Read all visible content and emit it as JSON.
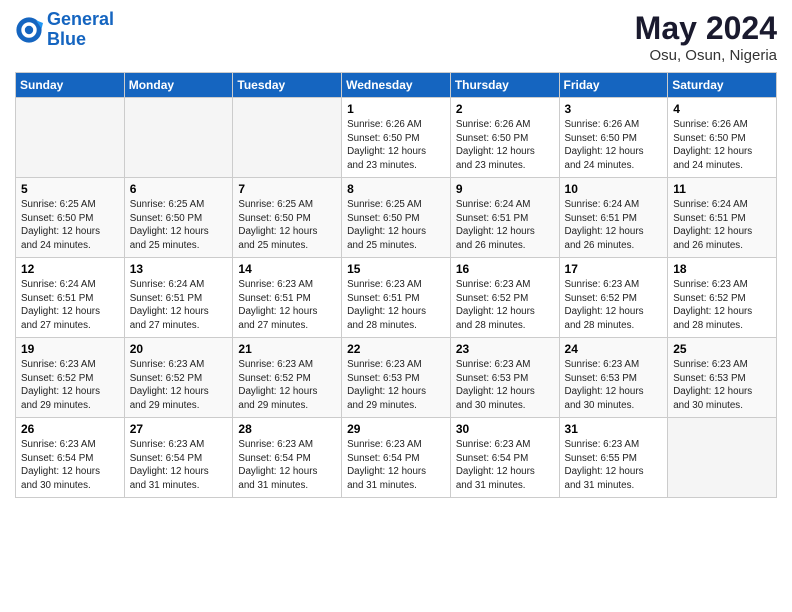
{
  "brand": {
    "line1": "General",
    "line2": "Blue"
  },
  "header": {
    "title": "May 2024",
    "location": "Osu, Osun, Nigeria"
  },
  "weekdays": [
    "Sunday",
    "Monday",
    "Tuesday",
    "Wednesday",
    "Thursday",
    "Friday",
    "Saturday"
  ],
  "weeks": [
    [
      {
        "day": "",
        "info": ""
      },
      {
        "day": "",
        "info": ""
      },
      {
        "day": "",
        "info": ""
      },
      {
        "day": "1",
        "info": "Sunrise: 6:26 AM\nSunset: 6:50 PM\nDaylight: 12 hours\nand 23 minutes."
      },
      {
        "day": "2",
        "info": "Sunrise: 6:26 AM\nSunset: 6:50 PM\nDaylight: 12 hours\nand 23 minutes."
      },
      {
        "day": "3",
        "info": "Sunrise: 6:26 AM\nSunset: 6:50 PM\nDaylight: 12 hours\nand 24 minutes."
      },
      {
        "day": "4",
        "info": "Sunrise: 6:26 AM\nSunset: 6:50 PM\nDaylight: 12 hours\nand 24 minutes."
      }
    ],
    [
      {
        "day": "5",
        "info": "Sunrise: 6:25 AM\nSunset: 6:50 PM\nDaylight: 12 hours\nand 24 minutes."
      },
      {
        "day": "6",
        "info": "Sunrise: 6:25 AM\nSunset: 6:50 PM\nDaylight: 12 hours\nand 25 minutes."
      },
      {
        "day": "7",
        "info": "Sunrise: 6:25 AM\nSunset: 6:50 PM\nDaylight: 12 hours\nand 25 minutes."
      },
      {
        "day": "8",
        "info": "Sunrise: 6:25 AM\nSunset: 6:50 PM\nDaylight: 12 hours\nand 25 minutes."
      },
      {
        "day": "9",
        "info": "Sunrise: 6:24 AM\nSunset: 6:51 PM\nDaylight: 12 hours\nand 26 minutes."
      },
      {
        "day": "10",
        "info": "Sunrise: 6:24 AM\nSunset: 6:51 PM\nDaylight: 12 hours\nand 26 minutes."
      },
      {
        "day": "11",
        "info": "Sunrise: 6:24 AM\nSunset: 6:51 PM\nDaylight: 12 hours\nand 26 minutes."
      }
    ],
    [
      {
        "day": "12",
        "info": "Sunrise: 6:24 AM\nSunset: 6:51 PM\nDaylight: 12 hours\nand 27 minutes."
      },
      {
        "day": "13",
        "info": "Sunrise: 6:24 AM\nSunset: 6:51 PM\nDaylight: 12 hours\nand 27 minutes."
      },
      {
        "day": "14",
        "info": "Sunrise: 6:23 AM\nSunset: 6:51 PM\nDaylight: 12 hours\nand 27 minutes."
      },
      {
        "day": "15",
        "info": "Sunrise: 6:23 AM\nSunset: 6:51 PM\nDaylight: 12 hours\nand 28 minutes."
      },
      {
        "day": "16",
        "info": "Sunrise: 6:23 AM\nSunset: 6:52 PM\nDaylight: 12 hours\nand 28 minutes."
      },
      {
        "day": "17",
        "info": "Sunrise: 6:23 AM\nSunset: 6:52 PM\nDaylight: 12 hours\nand 28 minutes."
      },
      {
        "day": "18",
        "info": "Sunrise: 6:23 AM\nSunset: 6:52 PM\nDaylight: 12 hours\nand 28 minutes."
      }
    ],
    [
      {
        "day": "19",
        "info": "Sunrise: 6:23 AM\nSunset: 6:52 PM\nDaylight: 12 hours\nand 29 minutes."
      },
      {
        "day": "20",
        "info": "Sunrise: 6:23 AM\nSunset: 6:52 PM\nDaylight: 12 hours\nand 29 minutes."
      },
      {
        "day": "21",
        "info": "Sunrise: 6:23 AM\nSunset: 6:52 PM\nDaylight: 12 hours\nand 29 minutes."
      },
      {
        "day": "22",
        "info": "Sunrise: 6:23 AM\nSunset: 6:53 PM\nDaylight: 12 hours\nand 29 minutes."
      },
      {
        "day": "23",
        "info": "Sunrise: 6:23 AM\nSunset: 6:53 PM\nDaylight: 12 hours\nand 30 minutes."
      },
      {
        "day": "24",
        "info": "Sunrise: 6:23 AM\nSunset: 6:53 PM\nDaylight: 12 hours\nand 30 minutes."
      },
      {
        "day": "25",
        "info": "Sunrise: 6:23 AM\nSunset: 6:53 PM\nDaylight: 12 hours\nand 30 minutes."
      }
    ],
    [
      {
        "day": "26",
        "info": "Sunrise: 6:23 AM\nSunset: 6:54 PM\nDaylight: 12 hours\nand 30 minutes."
      },
      {
        "day": "27",
        "info": "Sunrise: 6:23 AM\nSunset: 6:54 PM\nDaylight: 12 hours\nand 31 minutes."
      },
      {
        "day": "28",
        "info": "Sunrise: 6:23 AM\nSunset: 6:54 PM\nDaylight: 12 hours\nand 31 minutes."
      },
      {
        "day": "29",
        "info": "Sunrise: 6:23 AM\nSunset: 6:54 PM\nDaylight: 12 hours\nand 31 minutes."
      },
      {
        "day": "30",
        "info": "Sunrise: 6:23 AM\nSunset: 6:54 PM\nDaylight: 12 hours\nand 31 minutes."
      },
      {
        "day": "31",
        "info": "Sunrise: 6:23 AM\nSunset: 6:55 PM\nDaylight: 12 hours\nand 31 minutes."
      },
      {
        "day": "",
        "info": ""
      }
    ]
  ]
}
